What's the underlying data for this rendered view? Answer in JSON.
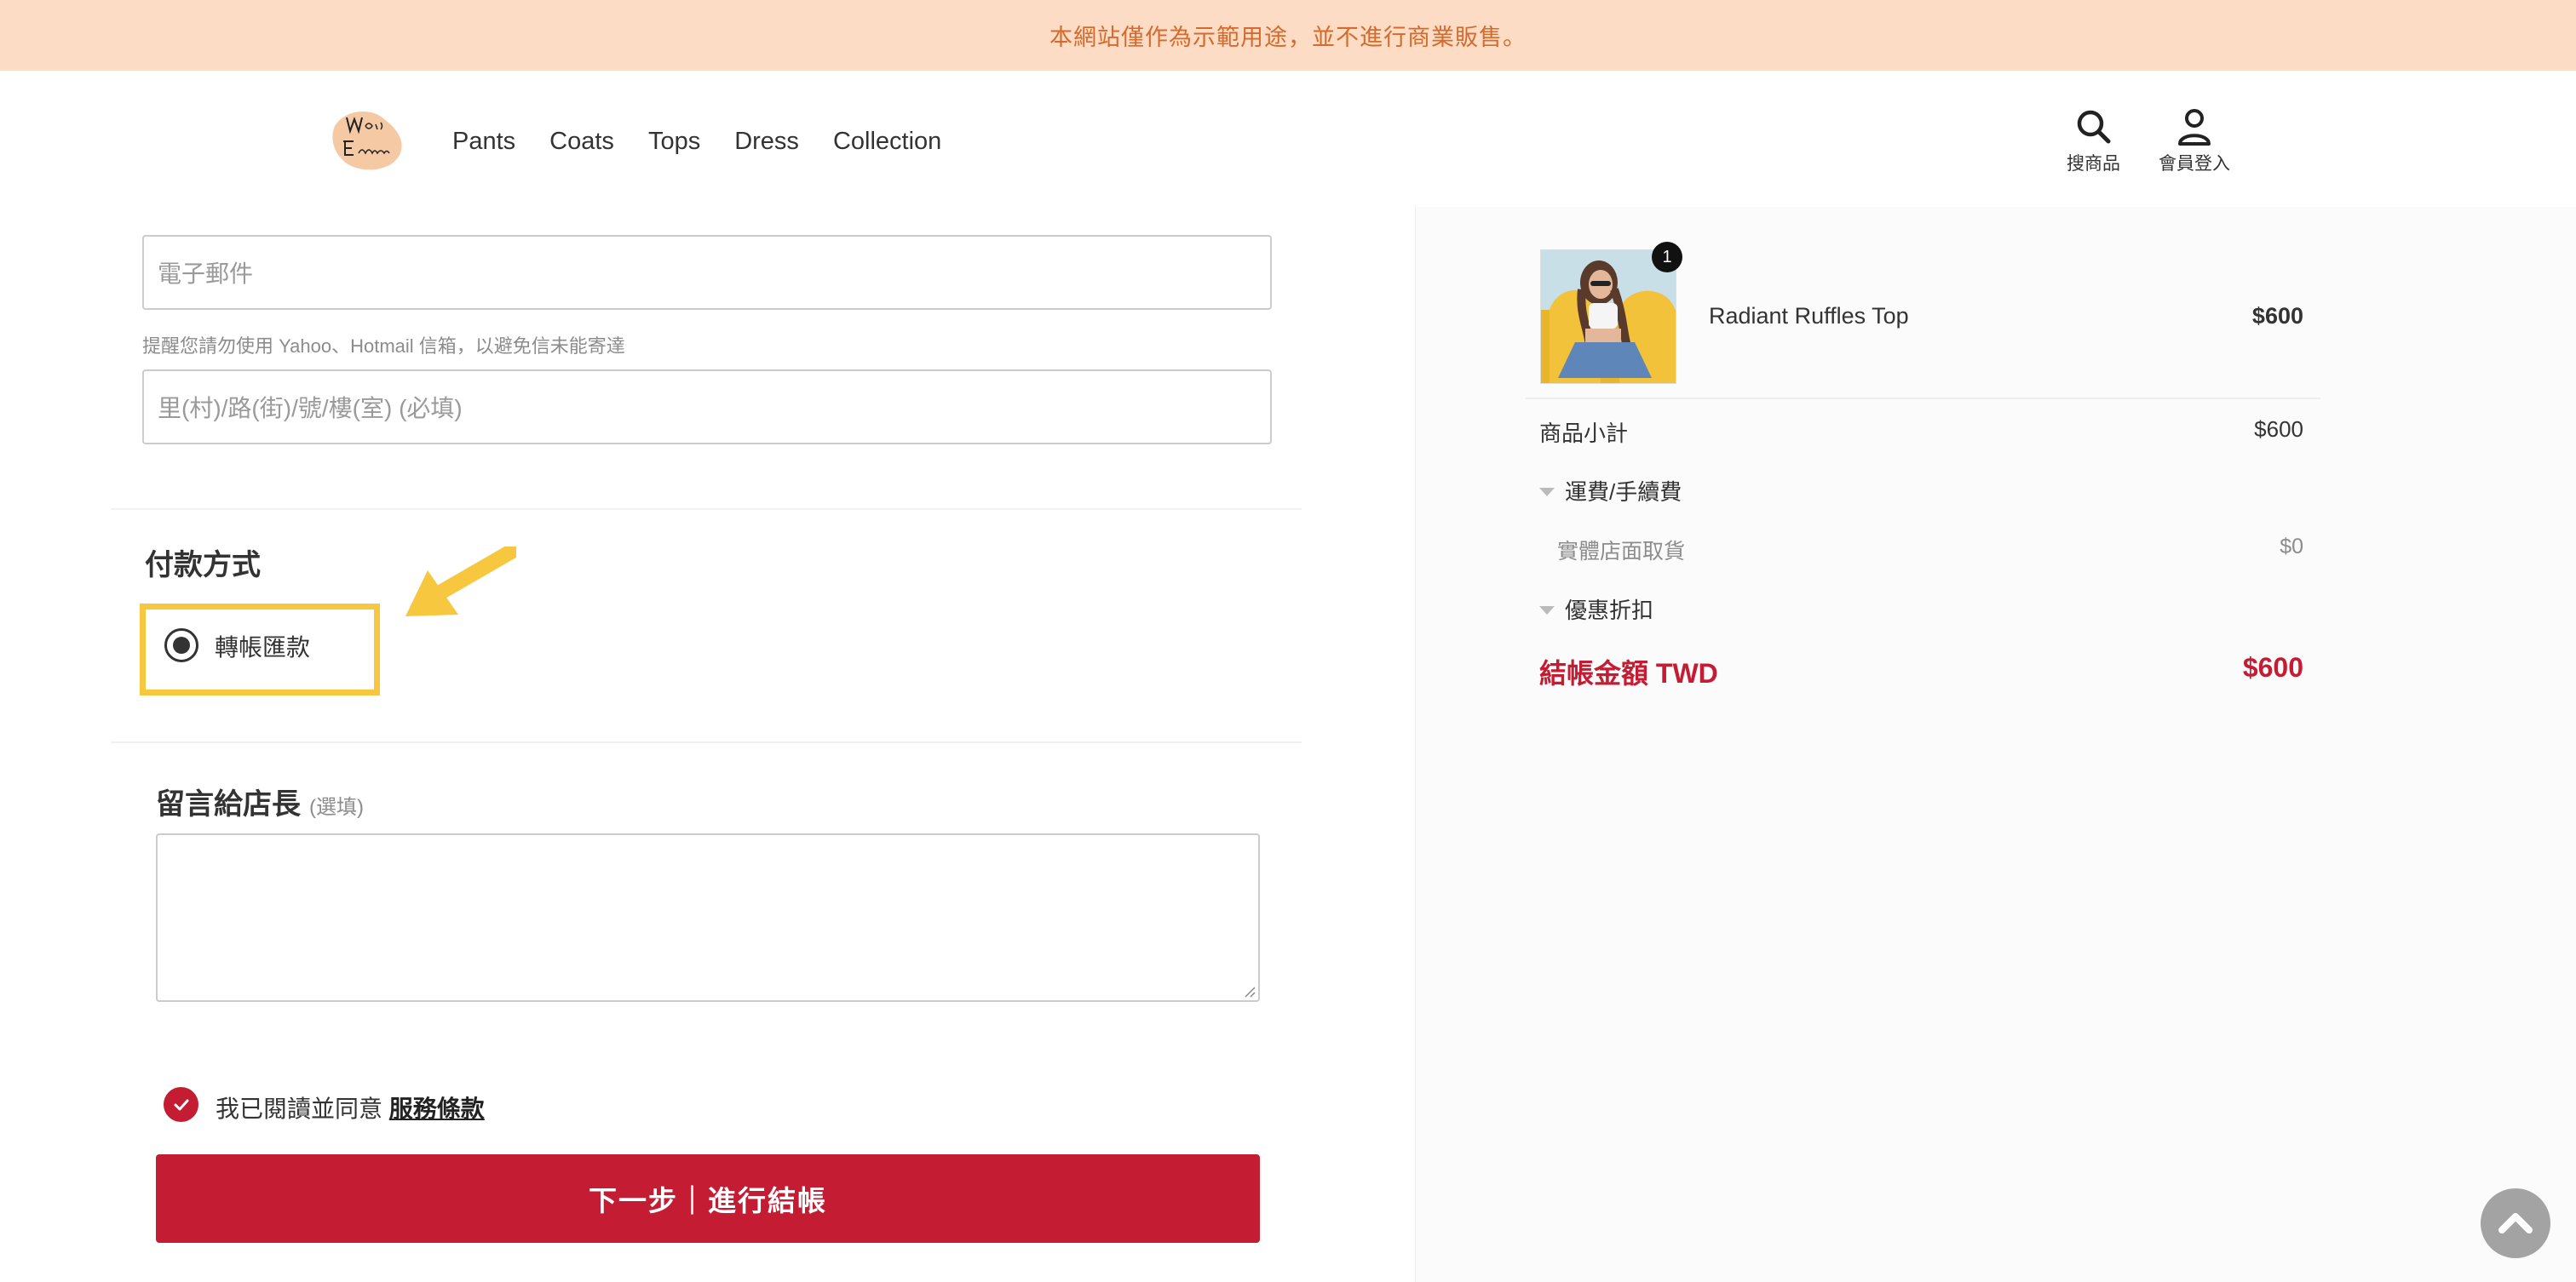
{
  "banner": {
    "text": "本網站僅作為示範用途，並不進行商業販售。"
  },
  "header": {
    "nav": [
      "Pants",
      "Coats",
      "Tops",
      "Dress",
      "Collection"
    ],
    "search_label": "搜商品",
    "account_label": "會員登入"
  },
  "form": {
    "email_placeholder": "電子郵件",
    "email_hint": "提醒您請勿使用 Yahoo、Hotmail 信箱，以避免信未能寄達",
    "address_placeholder": "里(村)/路(街)/號/樓(室) (必填)",
    "payment_title": "付款方式",
    "payment_option": "轉帳匯款",
    "message_title": "留言給店長",
    "message_optional": "(選填)",
    "agree_text": "我已閱讀並同意",
    "terms_link": "服務條款",
    "next_button": "下一步｜進行結帳"
  },
  "summary": {
    "item_qty": "1",
    "item_name": "Radiant Ruffles Top",
    "item_price": "$600",
    "subtotal_label": "商品小計",
    "subtotal_value": "$600",
    "shipping_label": "運費/手續費",
    "pickup_label": "實體店面取貨",
    "pickup_value": "$0",
    "discount_label": "優惠折扣",
    "total_label": "結帳金額 TWD",
    "total_value": "$600"
  },
  "colors": {
    "banner_bg": "#fddcc5",
    "banner_text": "#d46a2c",
    "accent": "#c41c33",
    "highlight": "#f7c73f"
  }
}
